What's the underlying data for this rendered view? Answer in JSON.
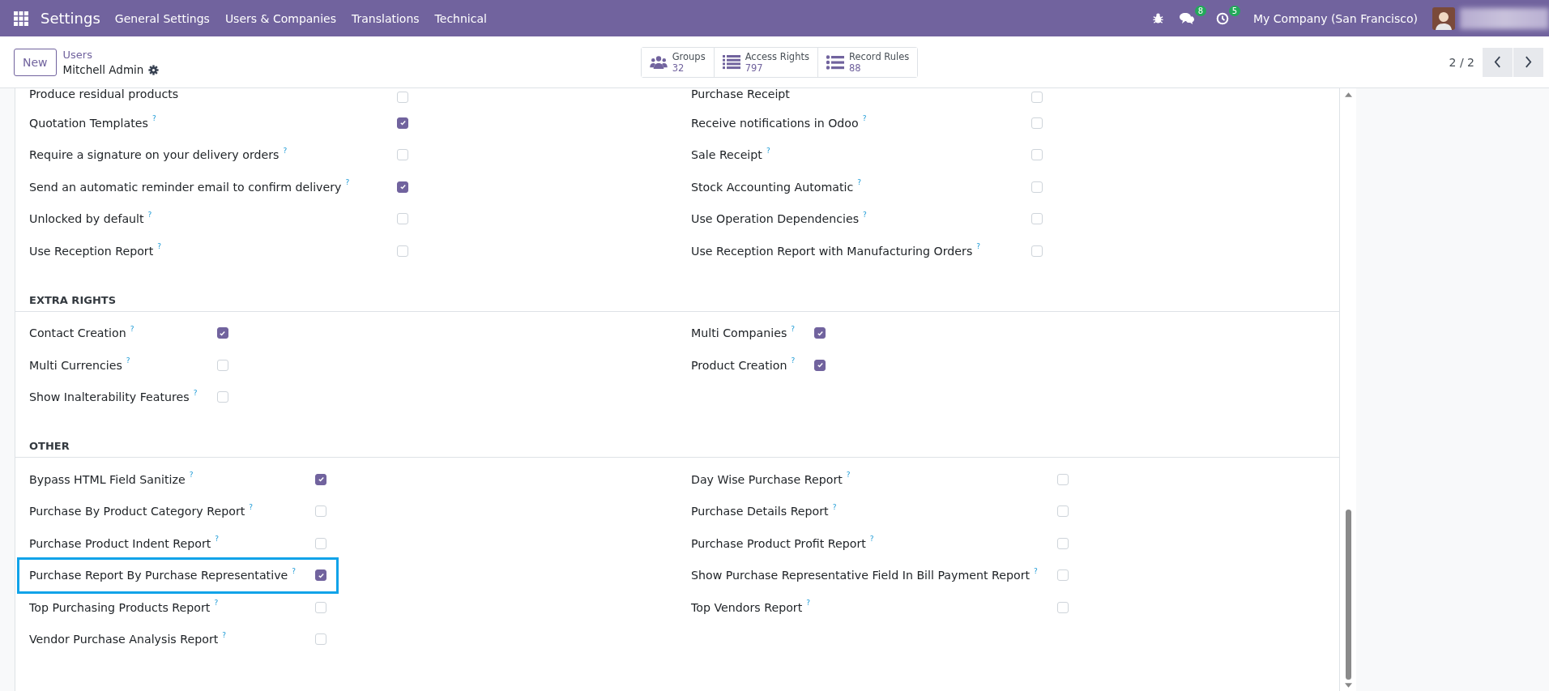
{
  "navbar": {
    "app_name": "Settings",
    "menu": [
      "General Settings",
      "Users & Companies",
      "Translations",
      "Technical"
    ],
    "chat_count": "8",
    "activity_count": "5",
    "company": "My Company (San Francisco)"
  },
  "control_panel": {
    "new_button": "New",
    "breadcrumb": "Users",
    "record": "Mitchell Admin",
    "stats": [
      {
        "kind": "users",
        "label": "Groups",
        "count": "32"
      },
      {
        "kind": "list",
        "label": "Access Rights",
        "count": "797"
      },
      {
        "kind": "rules",
        "label": "Record Rules",
        "count": "88"
      }
    ],
    "pager": "2 / 2"
  },
  "groups": [
    {
      "left": [
        {
          "label": "Produce residual products",
          "checked": false,
          "highlighted": false
        },
        {
          "label": "Quotation Templates",
          "help": "?",
          "checked": true,
          "highlighted": false
        },
        {
          "label": "Require a signature on your delivery orders",
          "help": "?",
          "checked": false,
          "highlighted": false
        },
        {
          "label": "Send an automatic reminder email to confirm delivery",
          "help": "?",
          "checked": true,
          "highlighted": false
        },
        {
          "label": "Unlocked by default",
          "help": "?",
          "checked": false,
          "highlighted": false
        },
        {
          "label": "Use Reception Report",
          "help": "?",
          "checked": false,
          "highlighted": false
        }
      ],
      "right": [
        {
          "label": "Purchase Receipt",
          "checked": false,
          "highlighted": false
        },
        {
          "label": "Receive notifications in Odoo",
          "help": "?",
          "checked": false,
          "highlighted": false
        },
        {
          "label": "Sale Receipt",
          "help": "?",
          "checked": false,
          "highlighted": false
        },
        {
          "label": "Stock Accounting Automatic",
          "help": "?",
          "checked": false,
          "highlighted": false
        },
        {
          "label": "Use Operation Dependencies",
          "help": "?",
          "checked": false,
          "highlighted": false
        },
        {
          "label": "Use Reception Report with Manufacturing Orders",
          "help": "?",
          "checked": false,
          "highlighted": false
        }
      ]
    },
    {
      "title": "EXTRA RIGHTS",
      "left": [
        {
          "label": "Contact Creation",
          "help": "?",
          "checked": true,
          "highlighted": false
        },
        {
          "label": "Multi Currencies",
          "help": "?",
          "checked": false,
          "highlighted": false
        },
        {
          "label": "Show Inalterability Features",
          "help": "?",
          "checked": false,
          "highlighted": false
        }
      ],
      "right": [
        {
          "label": "Multi Companies",
          "help": "?",
          "checked": true,
          "highlighted": false
        },
        {
          "label": "Product Creation",
          "help": "?",
          "checked": true,
          "highlighted": false
        }
      ]
    },
    {
      "title": "OTHER",
      "left": [
        {
          "label": "Bypass HTML Field Sanitize",
          "help": "?",
          "checked": true,
          "highlighted": false
        },
        {
          "label": "Purchase By Product Category Report",
          "help": "?",
          "checked": false,
          "highlighted": false
        },
        {
          "label": "Purchase Product Indent Report",
          "help": "?",
          "checked": false,
          "highlighted": false
        },
        {
          "label": "Purchase Report By Purchase Representative",
          "help": "?",
          "checked": true,
          "highlighted": true
        },
        {
          "label": "Top Purchasing Products Report",
          "help": "?",
          "checked": false,
          "highlighted": false
        },
        {
          "label": "Vendor Purchase Analysis Report",
          "help": "?",
          "checked": false,
          "highlighted": false
        }
      ],
      "right": [
        {
          "label": "Day Wise Purchase Report",
          "help": "?",
          "checked": false,
          "highlighted": false
        },
        {
          "label": "Purchase Details Report",
          "help": "?",
          "checked": false,
          "highlighted": false
        },
        {
          "label": "Purchase Product Profit Report",
          "help": "?",
          "checked": false,
          "highlighted": false
        },
        {
          "label": "Show Purchase Representative Field In Bill Payment Report",
          "help": "?",
          "checked": false,
          "highlighted": false
        },
        {
          "label": "Top Vendors Report",
          "help": "?",
          "checked": false,
          "highlighted": false
        }
      ]
    }
  ]
}
